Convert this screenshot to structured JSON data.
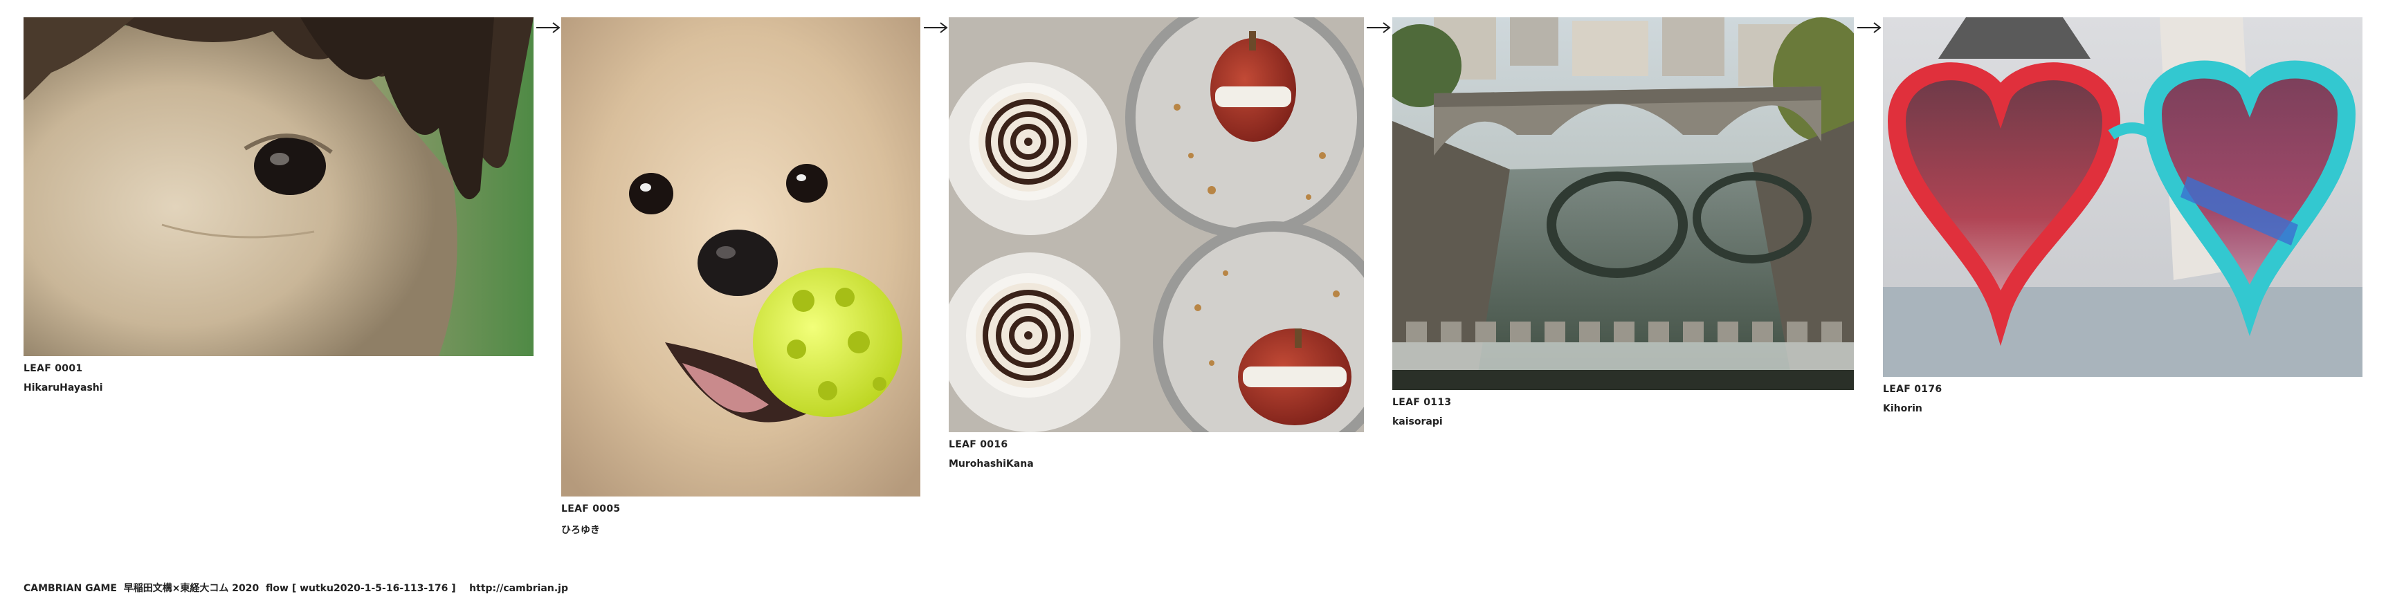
{
  "leaves": [
    {
      "label": "LEAF 0001",
      "author": "HikaruHayashi",
      "subject": "horse-face"
    },
    {
      "label": "LEAF 0005",
      "author": "ひろゆき",
      "subject": "dog-with-ball"
    },
    {
      "label": "LEAF 0016",
      "author": "MurohashiKana",
      "subject": "coffee-and-apples"
    },
    {
      "label": "LEAF 0113",
      "author": "kaisorapi",
      "subject": "stone-bridge-river"
    },
    {
      "label": "LEAF 0176",
      "author": "Kihorin",
      "subject": "heart-sunglasses"
    }
  ],
  "arrow_icon": "right-arrow-icon",
  "footer": {
    "text": "CAMBRIAN GAME  早稲田文構×東経大コム 2020  flow [ wutku2020-1-5-16-113-176 ]    ",
    "link": "http://cambrian.jp"
  },
  "colors": {
    "background": "#ffffff",
    "text": "#222222"
  }
}
